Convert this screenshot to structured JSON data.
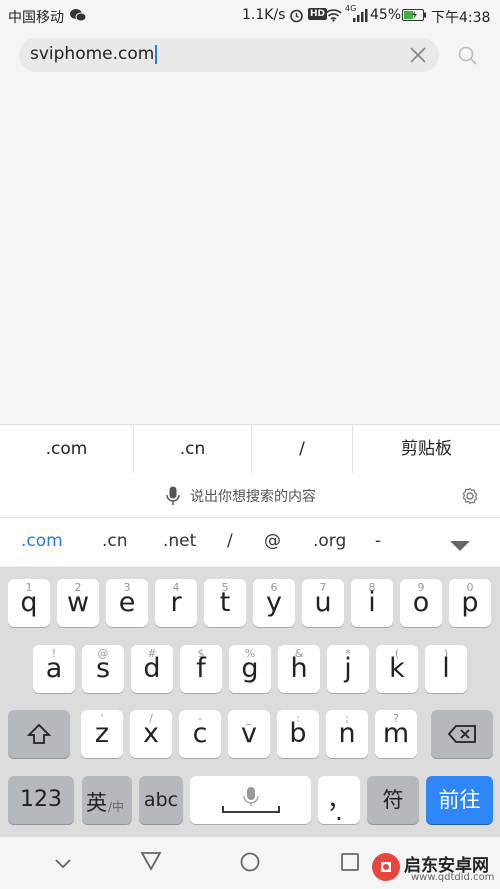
{
  "status_bar": {
    "carrier": "中国移动",
    "speed": "1.1K/s",
    "hd": "HD",
    "signal_label": "4G",
    "battery": "45%",
    "time": "下午4:38"
  },
  "search": {
    "value": "sviphome.com"
  },
  "quick_bar": {
    "items": [
      ".com",
      ".cn",
      "/",
      "剪贴板"
    ]
  },
  "voice_bar": {
    "prompt": "说出你想搜索的内容"
  },
  "suggestions": [
    ".com",
    ".cn",
    ".net",
    "/",
    "@",
    ".org",
    "-"
  ],
  "keyboard": {
    "row1": [
      {
        "k": "q",
        "h": "1"
      },
      {
        "k": "w",
        "h": "2"
      },
      {
        "k": "e",
        "h": "3"
      },
      {
        "k": "r",
        "h": "4"
      },
      {
        "k": "t",
        "h": "5"
      },
      {
        "k": "y",
        "h": "6"
      },
      {
        "k": "u",
        "h": "7"
      },
      {
        "k": "i",
        "h": "8"
      },
      {
        "k": "o",
        "h": "9"
      },
      {
        "k": "p",
        "h": "0"
      }
    ],
    "row2": [
      {
        "k": "a",
        "h": "!"
      },
      {
        "k": "s",
        "h": "@"
      },
      {
        "k": "d",
        "h": "#"
      },
      {
        "k": "f",
        "h": "$"
      },
      {
        "k": "g",
        "h": "%"
      },
      {
        "k": "h",
        "h": "&"
      },
      {
        "k": "j",
        "h": "*"
      },
      {
        "k": "k",
        "h": "("
      },
      {
        "k": "l",
        "h": ")"
      }
    ],
    "row3": [
      {
        "k": "z",
        "h": "'"
      },
      {
        "k": "x",
        "h": "/"
      },
      {
        "k": "c",
        "h": "-"
      },
      {
        "k": "v",
        "h": "_"
      },
      {
        "k": "b",
        "h": ":"
      },
      {
        "k": "n",
        "h": ";"
      },
      {
        "k": "m",
        "h": "?"
      }
    ],
    "num_label": "123",
    "lang_main": "英",
    "lang_sub": "/中",
    "abc_label": "abc",
    "punct_label": "，",
    "symbol_label": "符",
    "go_label": "前往"
  },
  "watermark": {
    "brand": "启东安卓网",
    "url": "www.qdtdid.com"
  },
  "colors": {
    "accent": "#2f86f6",
    "suggest_accent": "#2a7ae2"
  }
}
